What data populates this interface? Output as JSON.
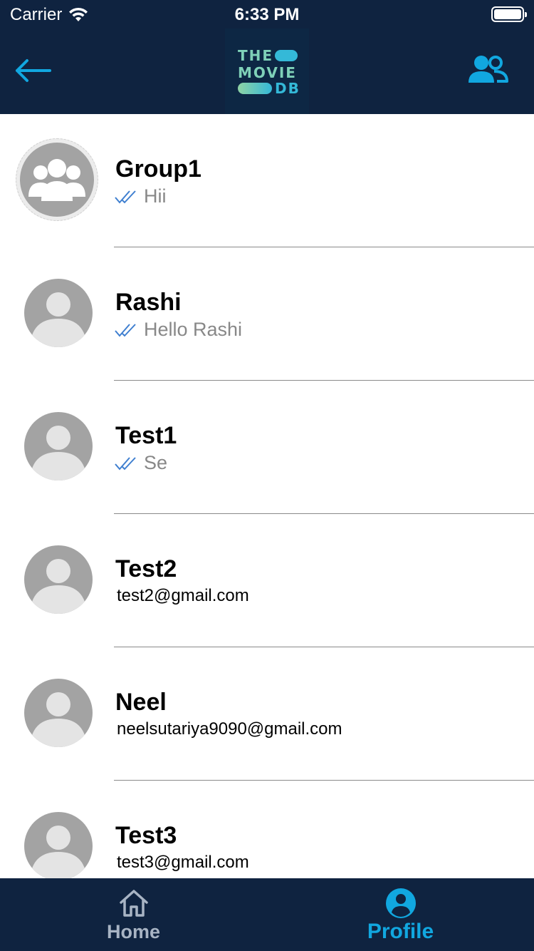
{
  "status_bar": {
    "carrier": "Carrier",
    "time": "6:33 PM"
  },
  "nav": {
    "back_icon": "arrow-left-icon",
    "logo": {
      "line1": "THE",
      "line2": "MOVIE",
      "line3": "DB"
    },
    "right_icon": "users-icon"
  },
  "chats": [
    {
      "name": "Group1",
      "last_message": "Hii",
      "avatar": "group-avatar-icon",
      "read_icon": "double-check-icon"
    },
    {
      "name": "Rashi",
      "last_message": "Hello Rashi",
      "avatar": "person-avatar-icon",
      "read_icon": "double-check-icon"
    },
    {
      "name": "Test1",
      "last_message": "Se",
      "avatar": "person-avatar-icon",
      "read_icon": "double-check-icon"
    },
    {
      "name": "Test2",
      "email": "test2@gmail.com",
      "avatar": "person-avatar-icon"
    },
    {
      "name": "Neel",
      "email": "neelsutariya9090@gmail.com",
      "avatar": "person-avatar-icon"
    },
    {
      "name": "Test3",
      "email": "test3@gmail.com",
      "avatar": "person-avatar-icon"
    }
  ],
  "tab_bar": {
    "items": [
      {
        "label": "Home",
        "icon": "home-icon",
        "active": false
      },
      {
        "label": "Profile",
        "icon": "profile-icon",
        "active": true
      }
    ]
  },
  "colors": {
    "nav_background": "#0f2340",
    "accent": "#11a7e0",
    "avatar_grey": "#a3a3a3",
    "divider": "#8a8a8a",
    "check_blue": "#3f7fd0"
  }
}
